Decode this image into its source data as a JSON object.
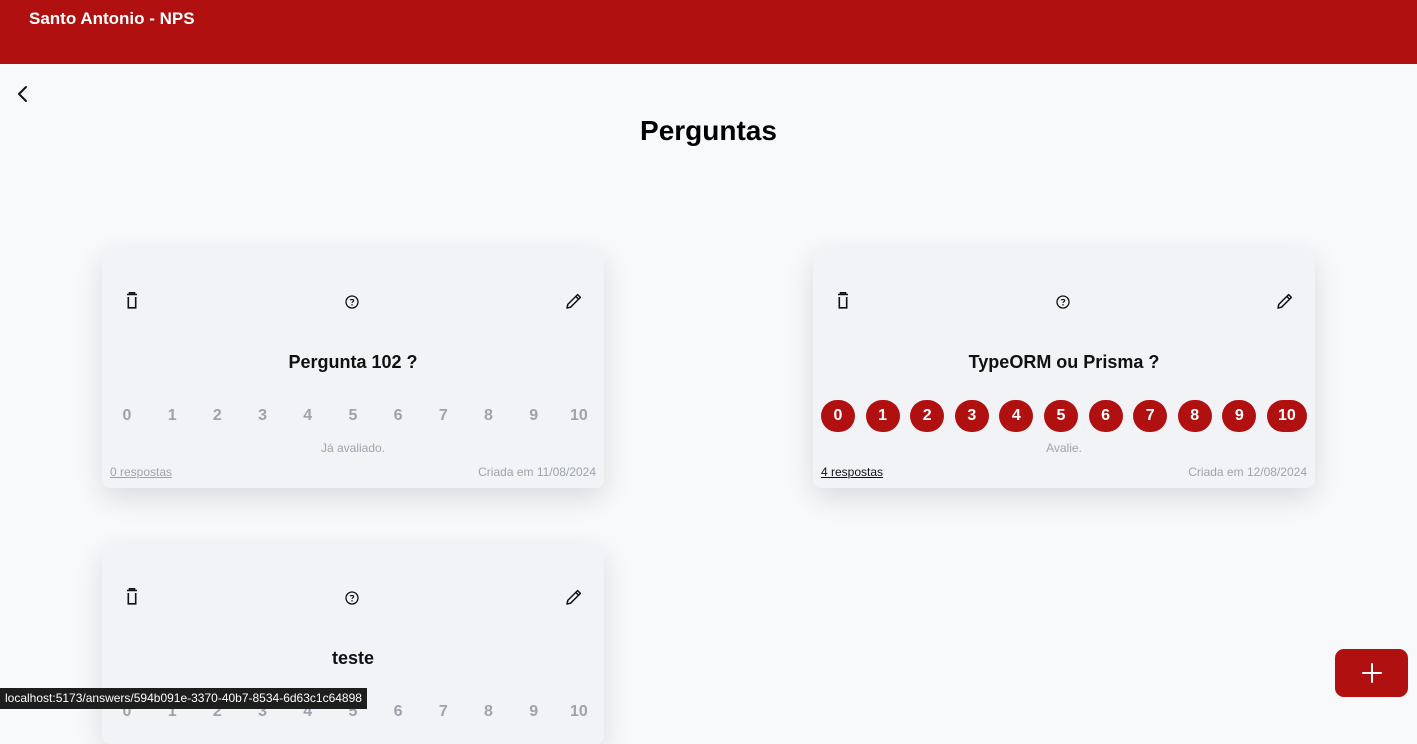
{
  "app": {
    "title": "Santo Antonio - NPS",
    "accent": "#b01010"
  },
  "page": {
    "title": "Perguntas"
  },
  "scale_labels": [
    "0",
    "1",
    "2",
    "3",
    "4",
    "5",
    "6",
    "7",
    "8",
    "9",
    "10"
  ],
  "cards": [
    {
      "title": "Pergunta 102 ?",
      "status": "Já avaliado.",
      "responses": "0 respostas",
      "created": "Criada em 11/08/2024"
    },
    {
      "title": "TypeORM ou Prisma ?",
      "status": "Avalie.",
      "responses": "4 respostas",
      "created": "Criada em 12/08/2024"
    },
    {
      "title": "teste"
    }
  ],
  "statusbar": {
    "url": "localhost:5173/answers/594b091e-3370-40b7-8534-6d63c1c64898"
  },
  "icons": [
    "chevron-left-icon",
    "trash-icon",
    "help-circle-icon",
    "pencil-icon",
    "plus-icon"
  ]
}
